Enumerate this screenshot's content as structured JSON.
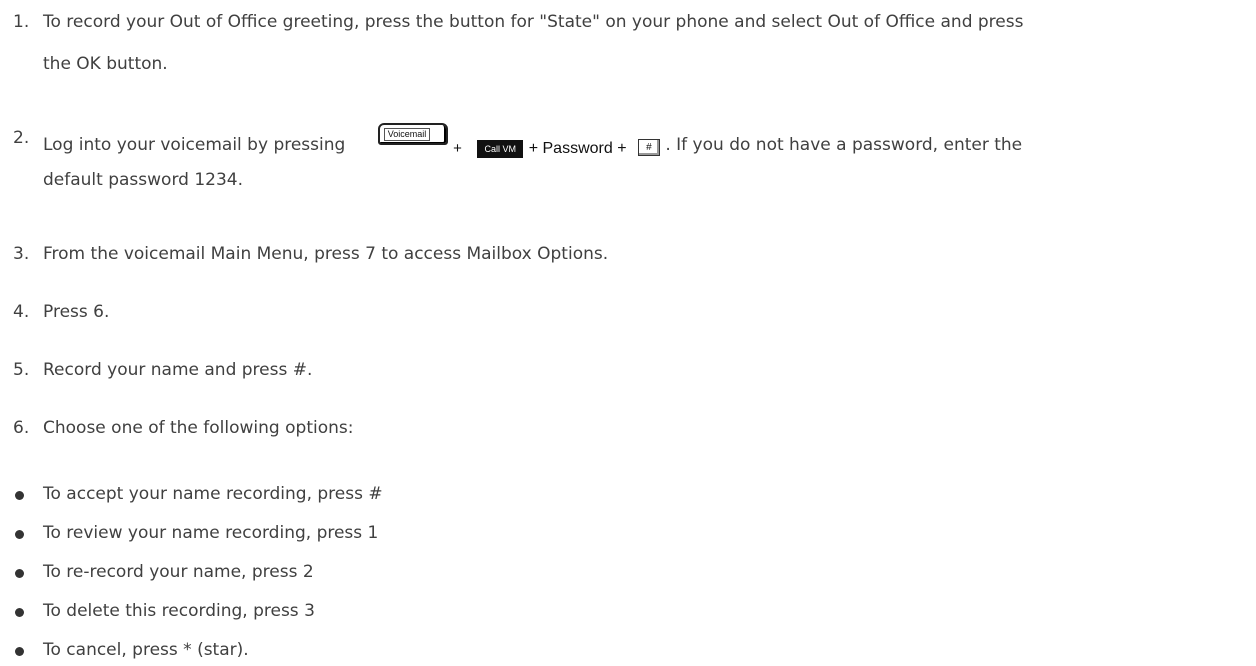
{
  "steps": [
    {
      "num": "1.",
      "line1": "To record your Out of Office greeting, press the button for \"State\" on your phone and select Out of Office and press",
      "line2": "the OK button."
    },
    {
      "num": "2.",
      "line1_before": "Log into your voicemail by pressing",
      "key_voicemail": "Voicemail",
      "plus1": "+",
      "key_callvm": "Call VM",
      "password_text": "+ Password +",
      "key_hash": "#",
      "line1_after": ". If you do not have a password, enter the",
      "line2": "default password 1234."
    },
    {
      "num": "3.",
      "line1": "From the voicemail Main Menu, press 7 to access Mailbox Options."
    },
    {
      "num": "4.",
      "line1": "Press 6."
    },
    {
      "num": "5.",
      "line1": "Record your name and press #."
    },
    {
      "num": "6.",
      "line1": "Choose one of the following options:"
    }
  ],
  "options": [
    "To accept your name recording, press #",
    "To review your name recording, press 1",
    "To re-record your name, press 2",
    "To delete this recording, press 3",
    "To cancel, press * (star)."
  ]
}
